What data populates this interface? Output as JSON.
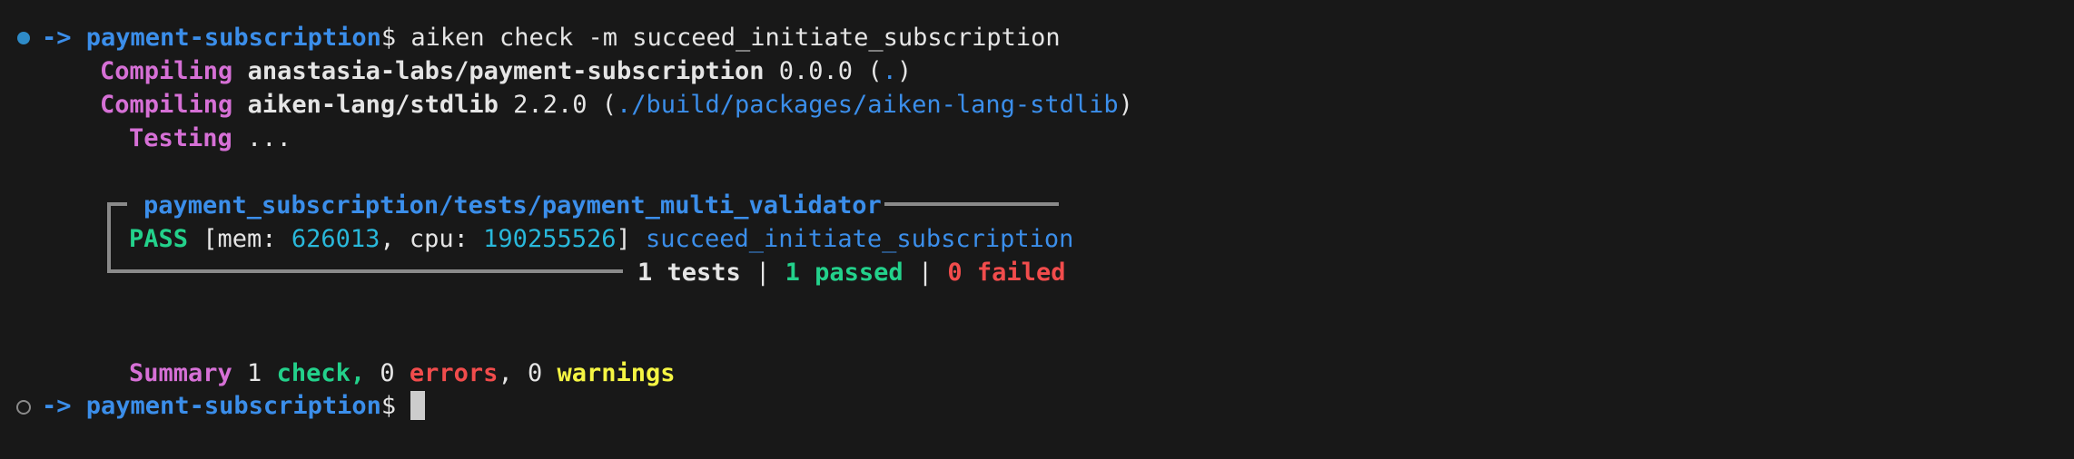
{
  "prompt": {
    "arrow": "->",
    "cwd": "payment-subscription",
    "symbol": "$"
  },
  "command": " aiken check -m succeed_initiate_subscription",
  "compile_lines": [
    {
      "label": "Compiling",
      "package": "anastasia-labs/payment-subscription",
      "version": " 0.0.0 (",
      "path": ".",
      "close": ")"
    },
    {
      "label": "Compiling",
      "package": "aiken-lang/stdlib",
      "version": " 2.2.0 (",
      "path": "./build/packages/aiken-lang-stdlib",
      "close": ")"
    }
  ],
  "testing": {
    "label": "Testing",
    "rest": " ..."
  },
  "test_block": {
    "module": "payment_subscription/tests/payment_multi_validator",
    "result": {
      "status": "PASS",
      "open": " [mem: ",
      "mem": "626013",
      "sep": ", cpu: ",
      "cpu": "190255526",
      "close": "] ",
      "name": "succeed_initiate_subscription"
    },
    "summary": {
      "tests": "1 tests",
      "pipe": " | ",
      "passed": "1 passed",
      "failed": "0 failed"
    }
  },
  "summary": {
    "label": "Summary",
    "count": " 1 ",
    "check": "check,",
    "errors_count": " 0 ",
    "errors": "errors",
    "sep": ", 0 ",
    "warnings": "warnings"
  },
  "colors": {
    "background": "#181818",
    "prompt_blue": "#3b8eea",
    "magenta": "#d670d6",
    "green": "#23d18b",
    "red": "#f14c4c",
    "yellow": "#f5f543",
    "cyan": "#29b8db"
  }
}
